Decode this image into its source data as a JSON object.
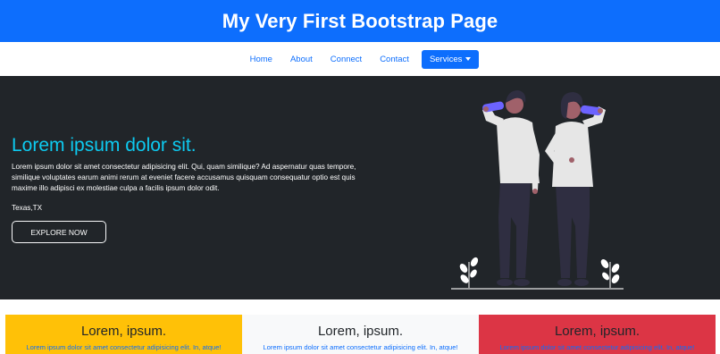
{
  "header": {
    "title": "My Very First Bootstrap Page"
  },
  "nav": {
    "links": [
      "Home",
      "About",
      "Connect",
      "Contact"
    ],
    "services_label": "Services"
  },
  "hero": {
    "title": "Lorem ipsum dolor sit.",
    "text": "Lorem ipsum dolor sit amet consectetur adipisicing elit. Qui, quam similique? Ad aspernatur quas tempore, similique voluptates earum animi rerum at eveniet facere accusamus quisquam consequatur optio est quis maxime illo adipisci ex molestiae culpa a facilis ipsum dolor odit.",
    "location": "Texas,TX",
    "button_label": "EXPLORE NOW"
  },
  "cards": [
    {
      "title": "Lorem, ipsum.",
      "text": "Lorem ipsum dolor sit amet consectetur adipisicing elit. In, atque!"
    },
    {
      "title": "Lorem, ipsum.",
      "text": "Lorem ipsum dolor sit amet consectetur adipisicing elit. In, atque!"
    },
    {
      "title": "Lorem, ipsum.",
      "text": "Lorem ipsum dolor sit amet consectetur adipisicing elit. In, atque!"
    }
  ],
  "colors": {
    "primary": "#0d6efd",
    "dark": "#212529",
    "info": "#0dcaf0",
    "warning": "#ffc107",
    "light": "#f8f9fa",
    "danger": "#dc3545"
  }
}
